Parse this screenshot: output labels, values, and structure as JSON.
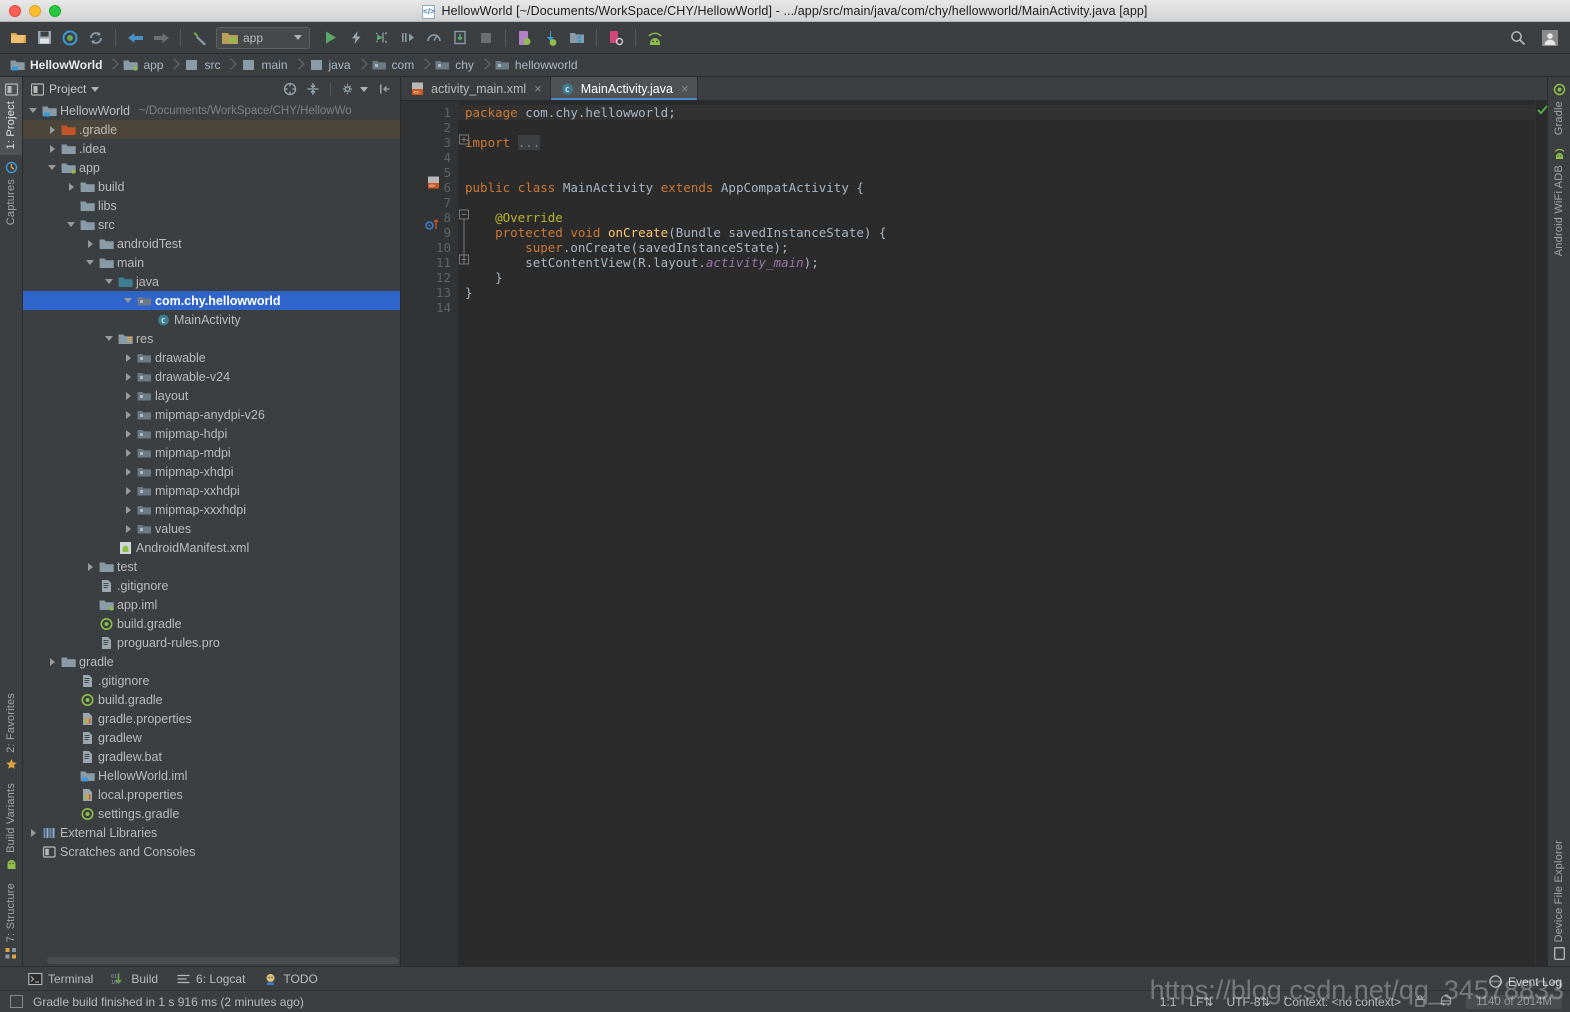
{
  "window": {
    "title": "HellowWorld [~/Documents/WorkSpace/CHY/HellowWorld] - .../app/src/main/java/com/chy/hellowworld/MainActivity.java [app]",
    "icon": "xml-file-icon"
  },
  "toolbar": {
    "icons": [
      {
        "name": "open-folder-icon"
      },
      {
        "name": "save-all-icon"
      },
      {
        "name": "sync-project-icon"
      },
      {
        "name": "refresh-icon"
      },
      {
        "name": "back-arrow-icon"
      },
      {
        "name": "forward-arrow-icon"
      },
      {
        "name": "build-hammer-icon"
      }
    ],
    "module_selector": {
      "label": "app",
      "icon": "android-module-icon"
    },
    "run_icons": [
      {
        "name": "run-icon"
      },
      {
        "name": "apply-changes-icon"
      },
      {
        "name": "debug-icon"
      },
      {
        "name": "run-to-cursor-icon"
      },
      {
        "name": "profiler-icon"
      },
      {
        "name": "attach-debugger-icon"
      },
      {
        "name": "stop-icon"
      },
      {
        "name": "avd-manager-icon"
      },
      {
        "name": "sdk-manager-icon"
      },
      {
        "name": "layout-inspector-icon"
      },
      {
        "name": "device-manager-icon"
      },
      {
        "name": "android-wifi-adb-icon"
      }
    ],
    "right_icons": [
      {
        "name": "search-icon"
      },
      {
        "name": "user-avatar-icon"
      }
    ]
  },
  "breadcrumbs": [
    {
      "label": "HellowWorld",
      "icon": "project-icon"
    },
    {
      "label": "app",
      "icon": "module-icon"
    },
    {
      "label": "src",
      "icon": "folder-icon"
    },
    {
      "label": "main",
      "icon": "folder-icon"
    },
    {
      "label": "java",
      "icon": "source-folder-icon"
    },
    {
      "label": "com",
      "icon": "package-icon"
    },
    {
      "label": "chy",
      "icon": "package-icon"
    },
    {
      "label": "hellowworld",
      "icon": "package-icon"
    }
  ],
  "left_strip": {
    "top": [
      {
        "label": "1: Project",
        "icon": "project-tool-icon",
        "active": true
      },
      {
        "label": "Captures",
        "icon": "captures-icon",
        "active": false
      }
    ],
    "bottom": [
      {
        "label": "2: Favorites",
        "icon": "star-icon"
      },
      {
        "label": "Build Variants",
        "icon": "android-green-icon"
      },
      {
        "label": "7: Structure",
        "icon": "structure-icon"
      }
    ]
  },
  "right_strip": {
    "top": [
      {
        "label": "Gradle",
        "icon": "gradle-icon"
      },
      {
        "label": "Android WiFi ADB",
        "icon": "android-wifi-icon"
      }
    ],
    "bottom": [
      {
        "label": "Device File Explorer",
        "icon": "device-file-icon"
      }
    ]
  },
  "project_panel": {
    "title": "Project",
    "header_icons": [
      {
        "name": "scroll-from-source-icon"
      },
      {
        "name": "collapse-all-icon"
      },
      {
        "name": "settings-gear-icon"
      },
      {
        "name": "hide-panel-icon"
      }
    ],
    "tree": [
      {
        "indent": 0,
        "twisty": "open",
        "icon": "project-icon",
        "label": "HellowWorld",
        "sub": "~/Documents/WorkSpace/CHY/HellowWo",
        "state": "normal"
      },
      {
        "indent": 1,
        "twisty": "closed",
        "icon": "folder-orange",
        "label": ".gradle",
        "sub": "",
        "state": "highlight"
      },
      {
        "indent": 1,
        "twisty": "closed",
        "icon": "folder-grey",
        "label": ".idea",
        "sub": "",
        "state": "normal"
      },
      {
        "indent": 1,
        "twisty": "open",
        "icon": "module-icon",
        "label": "app",
        "sub": "",
        "state": "normal"
      },
      {
        "indent": 2,
        "twisty": "closed",
        "icon": "folder-grey",
        "label": "build",
        "sub": "",
        "state": "normal"
      },
      {
        "indent": 2,
        "twisty": "none",
        "icon": "folder-grey",
        "label": "libs",
        "sub": "",
        "state": "normal"
      },
      {
        "indent": 2,
        "twisty": "open",
        "icon": "folder-grey",
        "label": "src",
        "sub": "",
        "state": "normal"
      },
      {
        "indent": 3,
        "twisty": "closed",
        "icon": "folder-grey",
        "label": "androidTest",
        "sub": "",
        "state": "normal"
      },
      {
        "indent": 3,
        "twisty": "open",
        "icon": "folder-grey",
        "label": "main",
        "sub": "",
        "state": "normal"
      },
      {
        "indent": 4,
        "twisty": "open",
        "icon": "folder-blue",
        "label": "java",
        "sub": "",
        "state": "normal"
      },
      {
        "indent": 5,
        "twisty": "open",
        "icon": "package-icon",
        "label": "com.chy.hellowworld",
        "sub": "",
        "state": "selected"
      },
      {
        "indent": 6,
        "twisty": "none",
        "icon": "class-icon",
        "label": "MainActivity",
        "sub": "",
        "state": "normal"
      },
      {
        "indent": 4,
        "twisty": "open",
        "icon": "res-folder",
        "label": "res",
        "sub": "",
        "state": "normal"
      },
      {
        "indent": 5,
        "twisty": "closed",
        "icon": "package-icon",
        "label": "drawable",
        "sub": "",
        "state": "normal"
      },
      {
        "indent": 5,
        "twisty": "closed",
        "icon": "package-icon",
        "label": "drawable-v24",
        "sub": "",
        "state": "normal"
      },
      {
        "indent": 5,
        "twisty": "closed",
        "icon": "package-icon",
        "label": "layout",
        "sub": "",
        "state": "normal"
      },
      {
        "indent": 5,
        "twisty": "closed",
        "icon": "package-icon",
        "label": "mipmap-anydpi-v26",
        "sub": "",
        "state": "normal"
      },
      {
        "indent": 5,
        "twisty": "closed",
        "icon": "package-icon",
        "label": "mipmap-hdpi",
        "sub": "",
        "state": "normal"
      },
      {
        "indent": 5,
        "twisty": "closed",
        "icon": "package-icon",
        "label": "mipmap-mdpi",
        "sub": "",
        "state": "normal"
      },
      {
        "indent": 5,
        "twisty": "closed",
        "icon": "package-icon",
        "label": "mipmap-xhdpi",
        "sub": "",
        "state": "normal"
      },
      {
        "indent": 5,
        "twisty": "closed",
        "icon": "package-icon",
        "label": "mipmap-xxhdpi",
        "sub": "",
        "state": "normal"
      },
      {
        "indent": 5,
        "twisty": "closed",
        "icon": "package-icon",
        "label": "mipmap-xxxhdpi",
        "sub": "",
        "state": "normal"
      },
      {
        "indent": 5,
        "twisty": "closed",
        "icon": "package-icon",
        "label": "values",
        "sub": "",
        "state": "normal"
      },
      {
        "indent": 4,
        "twisty": "none",
        "icon": "manifest-icon",
        "label": "AndroidManifest.xml",
        "sub": "",
        "state": "normal"
      },
      {
        "indent": 3,
        "twisty": "closed",
        "icon": "folder-grey",
        "label": "test",
        "sub": "",
        "state": "normal"
      },
      {
        "indent": 3,
        "twisty": "none",
        "icon": "file-icon",
        "label": ".gitignore",
        "sub": "",
        "state": "normal"
      },
      {
        "indent": 3,
        "twisty": "none",
        "icon": "module-icon",
        "label": "app.iml",
        "sub": "",
        "state": "normal"
      },
      {
        "indent": 3,
        "twisty": "none",
        "icon": "gradle-file",
        "label": "build.gradle",
        "sub": "",
        "state": "normal"
      },
      {
        "indent": 3,
        "twisty": "none",
        "icon": "file-icon",
        "label": "proguard-rules.pro",
        "sub": "",
        "state": "normal"
      },
      {
        "indent": 1,
        "twisty": "closed",
        "icon": "folder-grey",
        "label": "gradle",
        "sub": "",
        "state": "normal"
      },
      {
        "indent": 2,
        "twisty": "none",
        "icon": "file-icon",
        "label": ".gitignore",
        "sub": "",
        "state": "normal"
      },
      {
        "indent": 2,
        "twisty": "none",
        "icon": "gradle-file",
        "label": "build.gradle",
        "sub": "",
        "state": "normal"
      },
      {
        "indent": 2,
        "twisty": "none",
        "icon": "properties-icon",
        "label": "gradle.properties",
        "sub": "",
        "state": "normal"
      },
      {
        "indent": 2,
        "twisty": "none",
        "icon": "file-icon",
        "label": "gradlew",
        "sub": "",
        "state": "normal"
      },
      {
        "indent": 2,
        "twisty": "none",
        "icon": "file-icon",
        "label": "gradlew.bat",
        "sub": "",
        "state": "normal"
      },
      {
        "indent": 2,
        "twisty": "none",
        "icon": "project-icon",
        "label": "HellowWorld.iml",
        "sub": "",
        "state": "normal"
      },
      {
        "indent": 2,
        "twisty": "none",
        "icon": "properties-icon",
        "label": "local.properties",
        "sub": "",
        "state": "normal"
      },
      {
        "indent": 2,
        "twisty": "none",
        "icon": "gradle-file",
        "label": "settings.gradle",
        "sub": "",
        "state": "normal"
      },
      {
        "indent": 0,
        "twisty": "closed",
        "icon": "libraries-icon",
        "label": "External Libraries",
        "sub": "",
        "state": "normal"
      },
      {
        "indent": 0,
        "twisty": "none",
        "icon": "scratches-icon",
        "label": "Scratches and Consoles",
        "sub": "",
        "state": "normal"
      }
    ]
  },
  "editor": {
    "tabs": [
      {
        "label": "activity_main.xml",
        "icon": "xml-layout-icon",
        "active": false
      },
      {
        "label": "MainActivity.java",
        "icon": "java-class-icon",
        "active": true
      }
    ],
    "line_numbers": [
      "1",
      "2",
      "3",
      "4",
      "5",
      "6",
      "7",
      "8",
      "9",
      "10",
      "11",
      "12",
      "13",
      "14"
    ],
    "caret_line": 1,
    "code_lines": [
      [
        {
          "t": "package ",
          "c": "kw"
        },
        {
          "t": "com.chy.hellowworld;",
          "c": "pl"
        }
      ],
      [],
      [
        {
          "t": "import ",
          "c": "kw"
        },
        {
          "t": "...",
          "c": "dots"
        }
      ],
      [],
      [],
      [
        {
          "t": "public ",
          "c": "kw"
        },
        {
          "t": "class ",
          "c": "kw"
        },
        {
          "t": "MainActivity ",
          "c": "pl"
        },
        {
          "t": "extends ",
          "c": "kw"
        },
        {
          "t": "AppCompatActivity {",
          "c": "pl"
        }
      ],
      [],
      [
        {
          "t": "    @Override",
          "c": "an"
        }
      ],
      [
        {
          "t": "    protected ",
          "c": "kw"
        },
        {
          "t": "void ",
          "c": "kw"
        },
        {
          "t": "onCreate",
          "c": "fn"
        },
        {
          "t": "(Bundle savedInstanceState) {",
          "c": "pl"
        }
      ],
      [
        {
          "t": "        super",
          "c": "kw"
        },
        {
          "t": ".onCreate(savedInstanceState);",
          "c": "pl"
        }
      ],
      [
        {
          "t": "        setContentView(R.layout.",
          "c": "pl"
        },
        {
          "t": "activity_main",
          "c": "fld"
        },
        {
          "t": ");",
          "c": "pl"
        }
      ],
      [
        {
          "t": "    }",
          "c": "pl"
        }
      ],
      [
        {
          "t": "}",
          "c": "pl"
        }
      ],
      []
    ],
    "inspection_status": "ok"
  },
  "bottom_tabs": [
    {
      "label": "Terminal",
      "icon": "terminal-icon",
      "underline": ""
    },
    {
      "label": "Build",
      "icon": "build-icon",
      "underline": ""
    },
    {
      "label": "6: Logcat",
      "icon": "logcat-icon",
      "underline": "6"
    },
    {
      "label": "TODO",
      "icon": "todo-icon",
      "underline": ""
    }
  ],
  "statusbar": {
    "message": "Gradle build finished in 1 s 916 ms (2 minutes ago)",
    "caret_position": "1:1",
    "line_separator": "LF",
    "encoding": "UTF-8",
    "context": "Context: <no context>",
    "memory": "1140 of 2014M",
    "event_log": "Event Log",
    "icons": [
      {
        "name": "lock-icon"
      },
      {
        "name": "inspection-icon"
      }
    ]
  },
  "watermark": "https://blog.csdn.net/qq_34578833",
  "colors": {
    "accent_selection": "#2f65ca",
    "panel_bg": "#3c3f41",
    "editor_bg": "#2b2b2b",
    "gutter_bg": "#313335",
    "keyword": "#cc7832",
    "plain": "#a9b7c6",
    "method": "#ffc66d",
    "annotation": "#bbb529",
    "field": "#9876aa",
    "run_green": "#59a869"
  }
}
